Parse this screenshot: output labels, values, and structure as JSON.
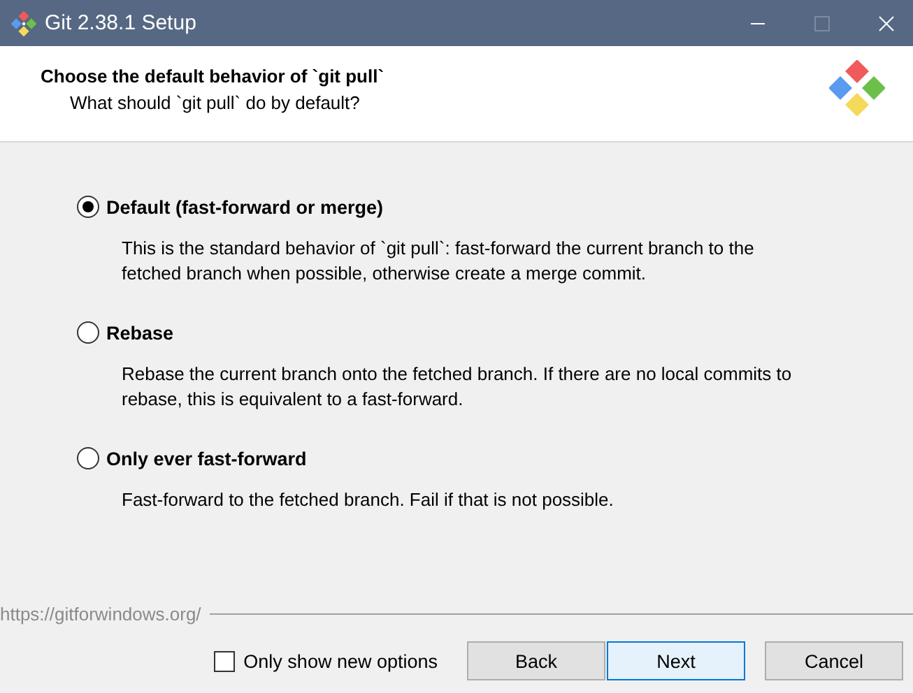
{
  "window": {
    "title": "Git 2.38.1 Setup",
    "maximize_disabled": true
  },
  "header": {
    "title": "Choose the default behavior of `git pull`",
    "subtitle": "What should `git pull` do by default?"
  },
  "options": [
    {
      "label": "Default (fast-forward or merge)",
      "selected": true,
      "description": "This is the standard behavior of `git pull`: fast-forward the current branch to the fetched branch when possible, otherwise create a merge commit."
    },
    {
      "label": "Rebase",
      "selected": false,
      "description": "Rebase the current branch onto the fetched branch. If there are no local commits to rebase, this is equivalent to a fast-forward."
    },
    {
      "label": "Only ever fast-forward",
      "selected": false,
      "description": "Fast-forward to the fetched branch. Fail if that is not possible."
    }
  ],
  "footer": {
    "link": "https://gitforwindows.org/",
    "only_new": {
      "label": "Only show new options",
      "checked": false
    },
    "buttons": [
      {
        "label": "Back",
        "kind": "normal"
      },
      {
        "label": "Next",
        "kind": "default"
      },
      {
        "label": "Cancel",
        "kind": "normal"
      }
    ]
  }
}
